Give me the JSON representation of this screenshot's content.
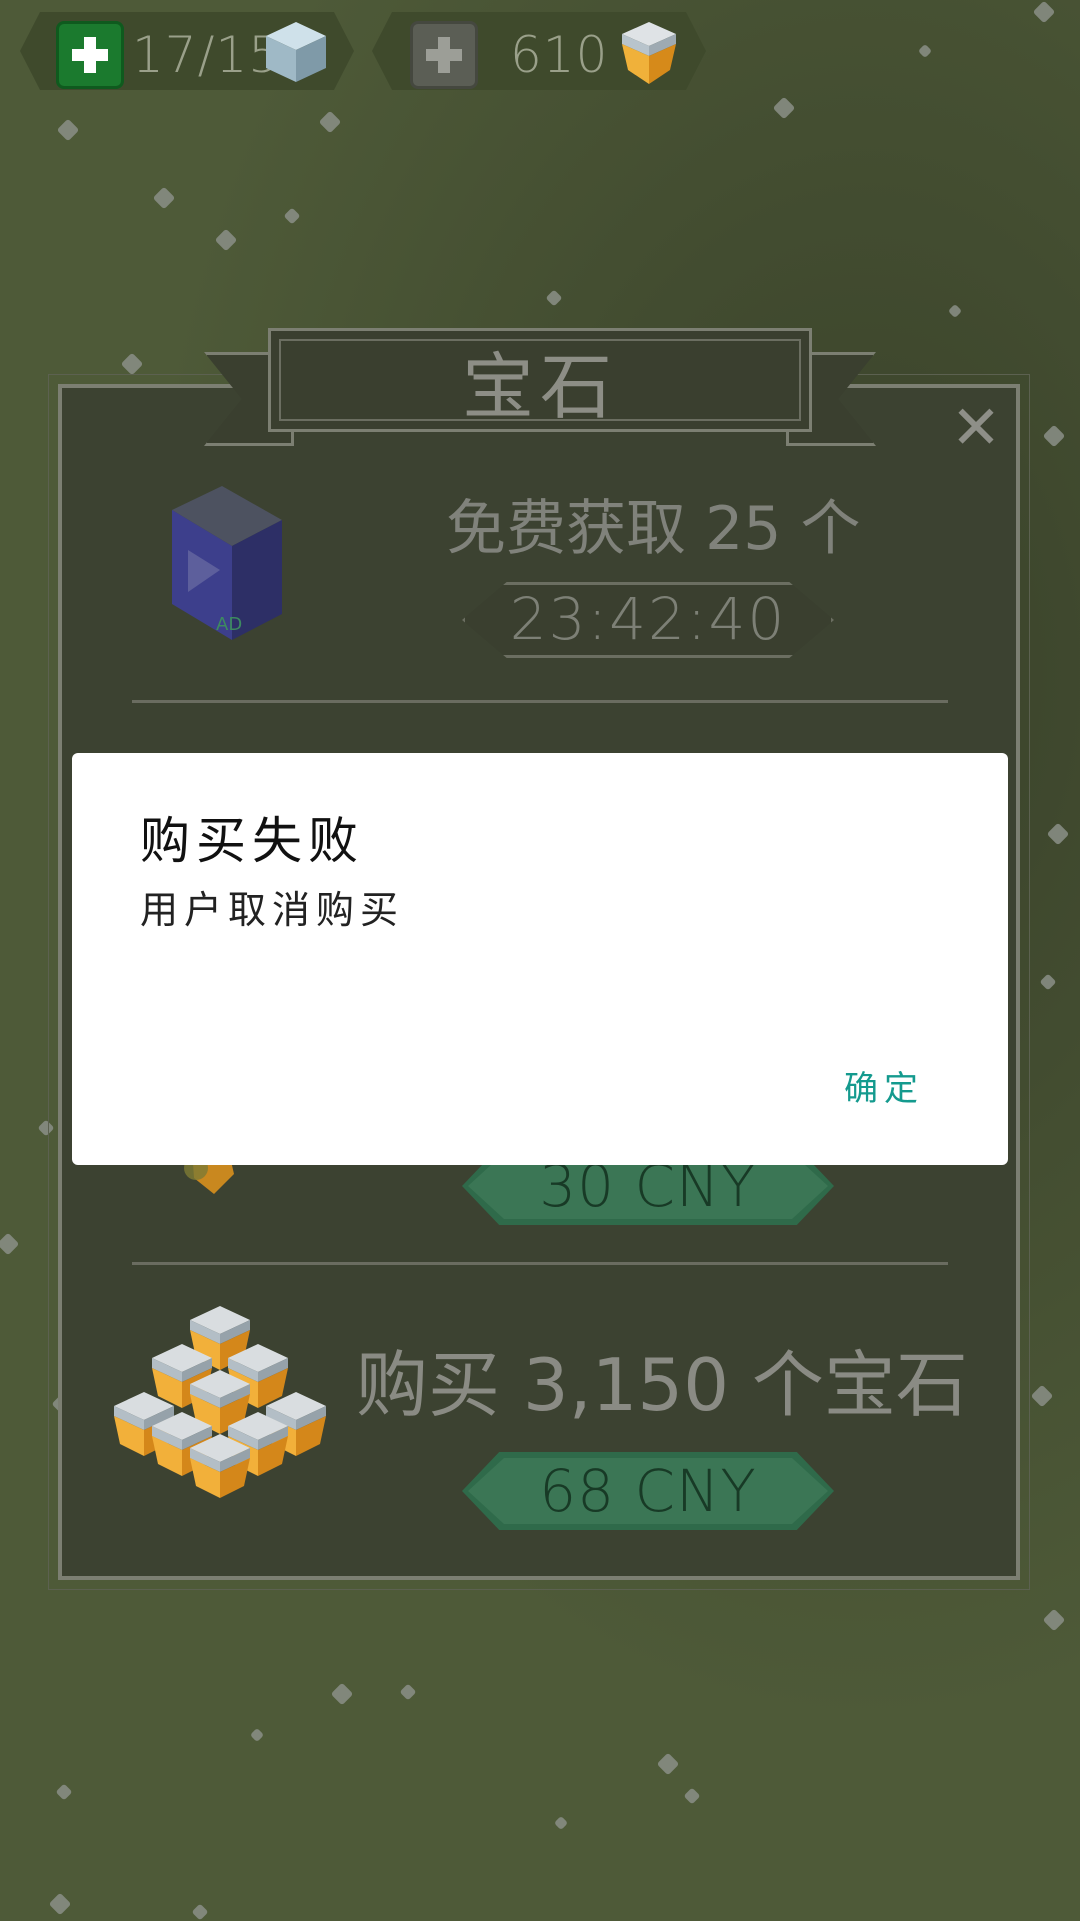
{
  "hud": {
    "energy": {
      "value": "17/15"
    },
    "gems": {
      "value": "610"
    }
  },
  "store": {
    "title": "宝石",
    "close_label": "✕",
    "free_offer": {
      "label": "免费获取 25 个",
      "timer": "23:42:40",
      "ad_badge": "AD"
    },
    "offers": [
      {
        "price": "30 CNY"
      },
      {
        "label": "购买 3,150 个宝石",
        "price": "68 CNY"
      }
    ]
  },
  "dialog": {
    "title": "购买失败",
    "message": "用户取消购买",
    "ok_label": "确定"
  },
  "colors": {
    "background": "#4e5a38",
    "panel": "#3c4231",
    "price_button": "#3b7655",
    "accent_ok": "#149a8e",
    "add_green": "#1f8a34"
  }
}
